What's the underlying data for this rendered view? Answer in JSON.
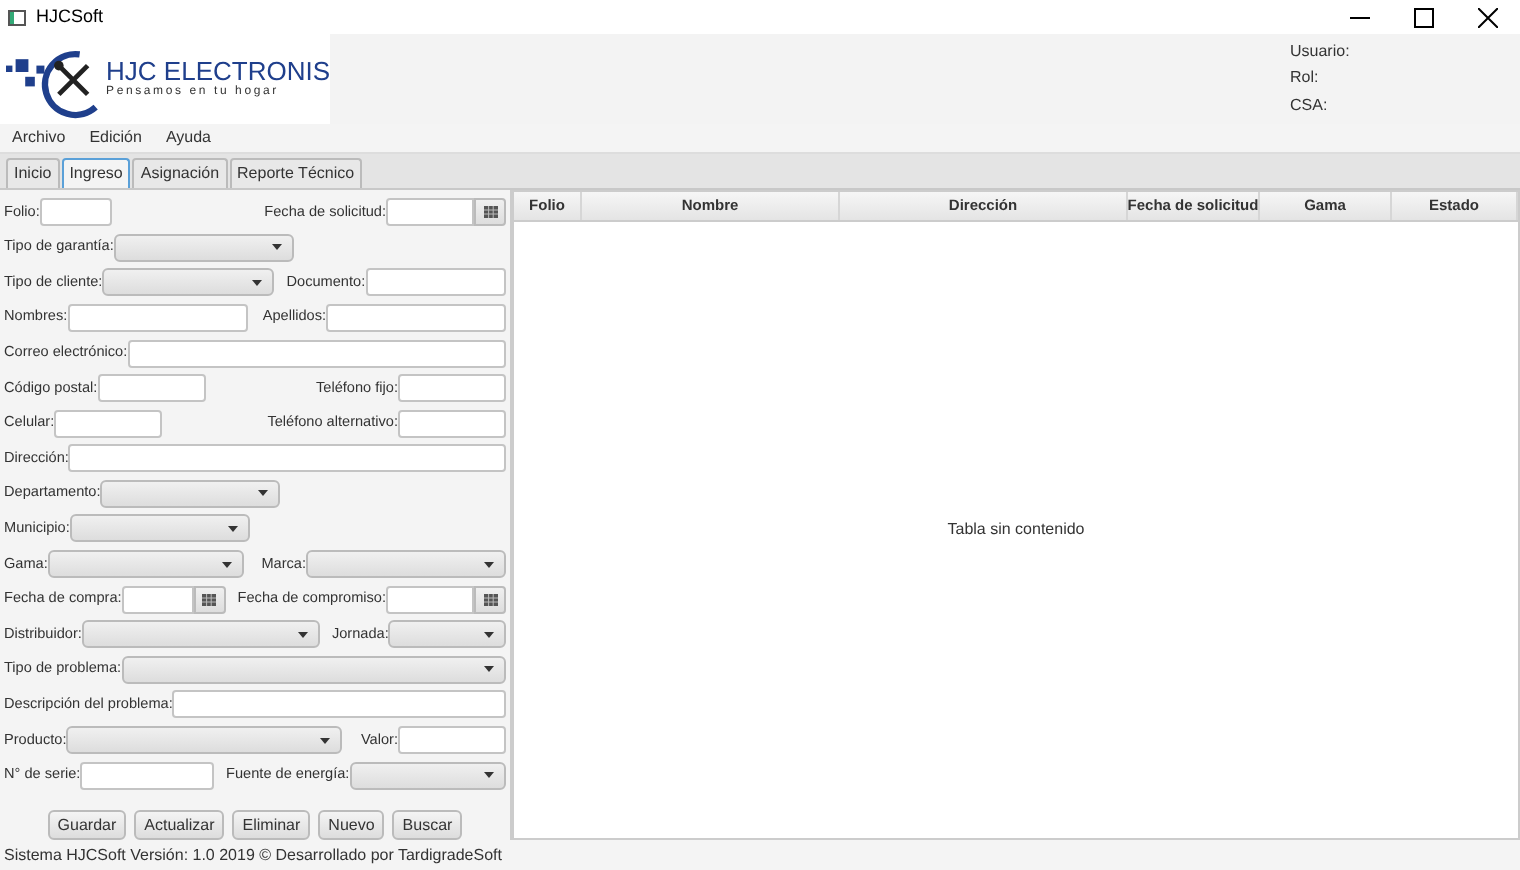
{
  "window": {
    "title": "HJCSoft"
  },
  "logo": {
    "name": "HJC ELECTRONIS",
    "tagline": "Pensamos en tu hogar"
  },
  "user_info": [
    "Usuario:",
    "Rol:",
    "CSA:"
  ],
  "menu": [
    "Archivo",
    "Edición",
    "Ayuda"
  ],
  "tabs": [
    {
      "label": "Inicio",
      "selected": false
    },
    {
      "label": "Ingreso",
      "selected": true
    },
    {
      "label": "Asignación",
      "selected": false
    },
    {
      "label": "Reporte Técnico",
      "selected": false
    }
  ],
  "form": [
    [
      {
        "label": "Folio:",
        "kind": "text"
      },
      {
        "label": "Fecha de solicitud:",
        "kind": "date"
      }
    ],
    [
      {
        "label": "Tipo de garantía:",
        "kind": "combo"
      }
    ],
    [
      {
        "label": "Tipo de cliente:",
        "kind": "combo"
      },
      {
        "label": "Documento:",
        "kind": "text"
      }
    ],
    [
      {
        "label": "Nombres:",
        "kind": "text"
      },
      {
        "label": "Apellidos:",
        "kind": "text"
      }
    ],
    [
      {
        "label": "Correo electrónico:",
        "kind": "text"
      }
    ],
    [
      {
        "label": "Código postal:",
        "kind": "text"
      },
      {
        "label": "Teléfono fijo:",
        "kind": "text"
      }
    ],
    [
      {
        "label": "Celular:",
        "kind": "text"
      },
      {
        "label": "Teléfono alternativo:",
        "kind": "text"
      }
    ],
    [
      {
        "label": "Dirección:",
        "kind": "text"
      }
    ],
    [
      {
        "label": "Departamento:",
        "kind": "combo"
      }
    ],
    [
      {
        "label": "Municipio:",
        "kind": "combo"
      }
    ],
    [
      {
        "label": "Gama:",
        "kind": "combo"
      },
      {
        "label": "Marca:",
        "kind": "combo"
      }
    ],
    [
      {
        "label": "Fecha de compra:",
        "kind": "date"
      },
      {
        "label": "Fecha de compromiso:",
        "kind": "date"
      }
    ],
    [
      {
        "label": "Distribuidor:",
        "kind": "combo"
      },
      {
        "label": "Jornada:",
        "kind": "combo"
      }
    ],
    [
      {
        "label": "Tipo de problema:",
        "kind": "combo"
      }
    ],
    [
      {
        "label": "Descripción del problema:",
        "kind": "text"
      }
    ],
    [
      {
        "label": "Producto:",
        "kind": "combo"
      },
      {
        "label": "Valor:",
        "kind": "text"
      }
    ],
    [
      {
        "label": "N° de serie:",
        "kind": "text"
      },
      {
        "label": "Fuente de energía:",
        "kind": "combo"
      }
    ]
  ],
  "buttons": [
    "Guardar",
    "Actualizar",
    "Eliminar",
    "Nuevo",
    "Buscar"
  ],
  "table": {
    "columns": [
      "Folio",
      "Nombre",
      "Dirección",
      "Fecha de solicitud",
      "Gama",
      "Estado"
    ],
    "empty_message": "Tabla sin contenido"
  },
  "status_bar": "Sistema HJCSoft Versión: 1.0 2019 © Desarrollado por TardigradeSoft"
}
